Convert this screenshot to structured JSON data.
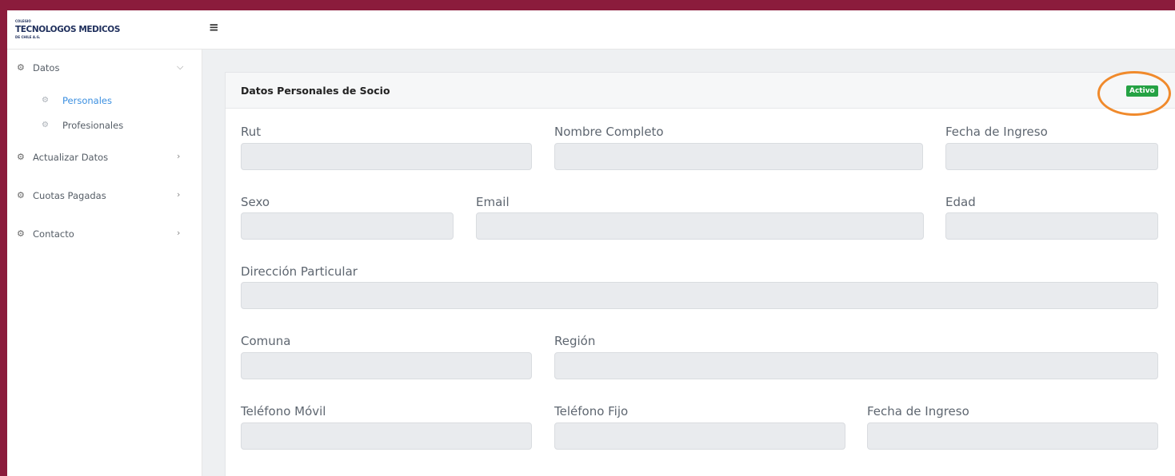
{
  "brand": {
    "line1": "COLEGIO",
    "line2": "TECNOLOGOS MEDICOS",
    "line3": "DE CHILE A.G."
  },
  "menu_toggle": "≡",
  "sidebar": {
    "items": [
      {
        "label": "Datos",
        "icon": "gears-icon",
        "chevron": "⌵"
      },
      {
        "label": "Actualizar Datos",
        "icon": "gears-icon",
        "chevron": "›"
      },
      {
        "label": "Cuotas Pagadas",
        "icon": "gears-icon",
        "chevron": "›"
      },
      {
        "label": "Contacto",
        "icon": "gears-icon",
        "chevron": "›"
      }
    ],
    "subitems": [
      {
        "label": "Personales",
        "active": true
      },
      {
        "label": "Profesionales",
        "active": false
      }
    ],
    "icon_glyph": "⚙"
  },
  "card": {
    "title": "Datos Personales de Socio",
    "status": "Activo",
    "status_color": "#25a244",
    "highlight_color": "#f08a2c"
  },
  "form": {
    "rut": {
      "label": "Rut",
      "value": ""
    },
    "nombre": {
      "label": "Nombre Completo",
      "value": ""
    },
    "fecha_ingreso": {
      "label": "Fecha de Ingreso",
      "value": ""
    },
    "sexo": {
      "label": "Sexo",
      "value": ""
    },
    "email": {
      "label": "Email",
      "value": ""
    },
    "edad": {
      "label": "Edad",
      "value": ""
    },
    "direccion": {
      "label": "Dirección Particular",
      "value": ""
    },
    "comuna": {
      "label": "Comuna",
      "value": ""
    },
    "region": {
      "label": "Región",
      "value": ""
    },
    "telefono_movil": {
      "label": "Teléfono Móvil",
      "value": ""
    },
    "telefono_fijo": {
      "label": "Teléfono Fijo",
      "value": ""
    },
    "fecha_ingreso_2": {
      "label": "Fecha de Ingreso",
      "value": ""
    }
  },
  "colors": {
    "frame": "#8b1c3c",
    "active_link": "#3b8fe0"
  }
}
